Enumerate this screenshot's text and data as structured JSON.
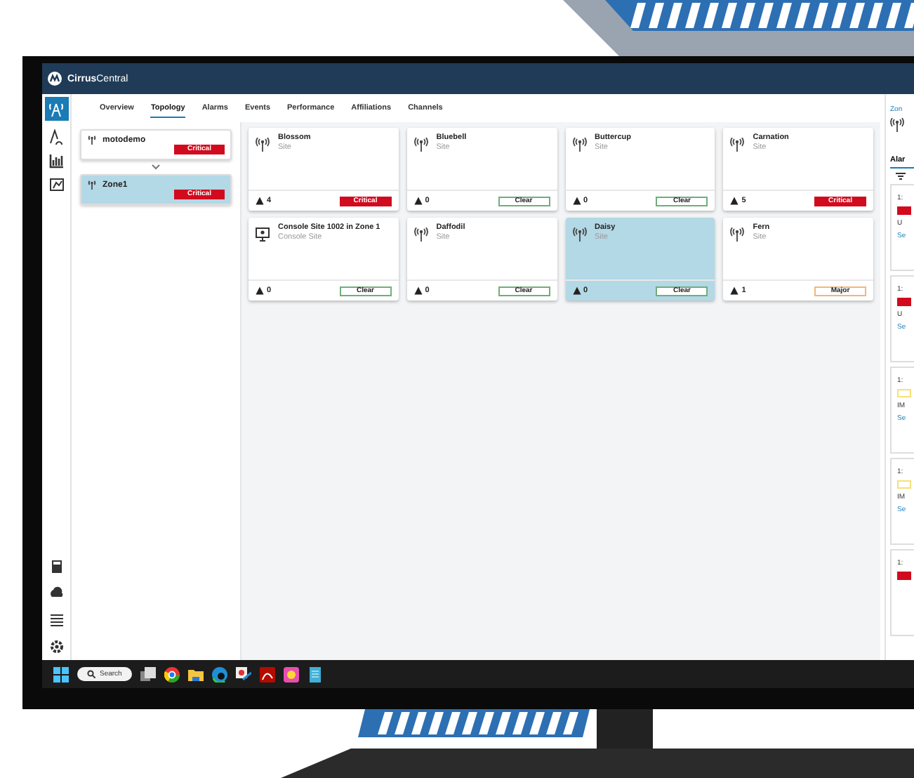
{
  "app": {
    "brand_bold": "Cirrus",
    "brand_light": "Central"
  },
  "tabs": [
    {
      "label": "Overview",
      "selected": false
    },
    {
      "label": "Topology",
      "selected": true
    },
    {
      "label": "Alarms",
      "selected": false
    },
    {
      "label": "Events",
      "selected": false
    },
    {
      "label": "Performance",
      "selected": false
    },
    {
      "label": "Affiliations",
      "selected": false
    },
    {
      "label": "Channels",
      "selected": false
    }
  ],
  "tree": [
    {
      "name": "motodemo",
      "severity": "Critical",
      "kind": "critical",
      "selected": false
    },
    {
      "name": "Zone1",
      "severity": "Critical",
      "kind": "critical",
      "selected": true
    }
  ],
  "sites": [
    {
      "name": "Blossom",
      "type": "Site",
      "alarms": "4",
      "severity": "Critical",
      "kind": "critical",
      "selected": false
    },
    {
      "name": "Bluebell",
      "type": "Site",
      "alarms": "0",
      "severity": "Clear",
      "kind": "clear",
      "selected": false
    },
    {
      "name": "Buttercup",
      "type": "Site",
      "alarms": "0",
      "severity": "Clear",
      "kind": "clear",
      "selected": false
    },
    {
      "name": "Carnation",
      "type": "Site",
      "alarms": "5",
      "severity": "Critical",
      "kind": "critical",
      "selected": false
    },
    {
      "name": "Console Site 1002 in Zone 1",
      "type": "Console Site",
      "alarms": "0",
      "severity": "Clear",
      "kind": "clear",
      "selected": false
    },
    {
      "name": "Daffodil",
      "type": "Site",
      "alarms": "0",
      "severity": "Clear",
      "kind": "clear",
      "selected": false
    },
    {
      "name": "Daisy",
      "type": "Site",
      "alarms": "0",
      "severity": "Clear",
      "kind": "clear",
      "selected": true
    },
    {
      "name": "Fern",
      "type": "Site",
      "alarms": "1",
      "severity": "Major",
      "kind": "major",
      "selected": false
    }
  ],
  "details": {
    "breadcrumb": "Zon",
    "tab": "Alar",
    "alarms": [
      {
        "time": "1:",
        "kind": "critical",
        "text": "U",
        "link": "Se"
      },
      {
        "time": "1:",
        "kind": "critical",
        "text": "U",
        "link": "Se"
      },
      {
        "time": "1:",
        "kind": "minor",
        "text": "IM",
        "link": "Se"
      },
      {
        "time": "1:",
        "kind": "minor",
        "text": "IM",
        "link": "Se"
      },
      {
        "time": "1:",
        "kind": "critical"
      }
    ]
  },
  "taskbar": {
    "search": "Search"
  }
}
